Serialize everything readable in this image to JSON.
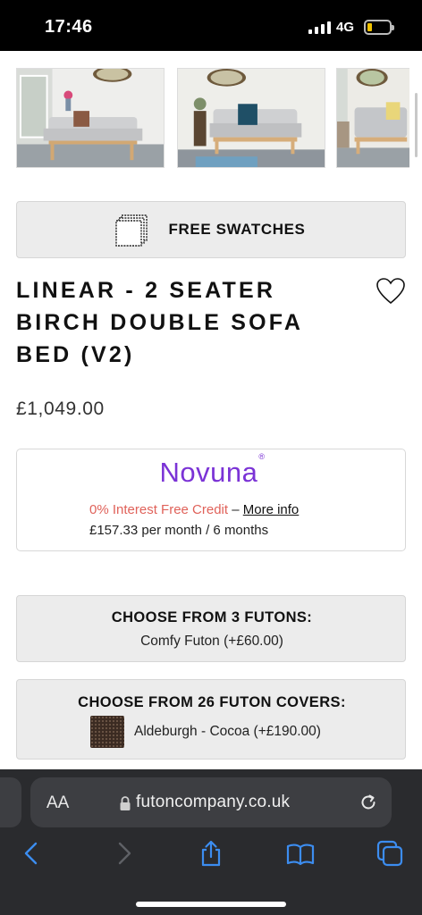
{
  "status_bar": {
    "time": "17:46",
    "network": "4G"
  },
  "gallery": {
    "images": [
      "sofa-bed-photo-1",
      "sofa-bed-photo-2",
      "sofa-bed-photo-3"
    ]
  },
  "swatches": {
    "label": "FREE SWATCHES",
    "icon": "swatch-icon"
  },
  "product": {
    "title": "LINEAR - 2 SEATER BIRCH DOUBLE SOFA BED (V2)",
    "price": "£1,049.00",
    "wishlist_icon": "heart-icon"
  },
  "finance": {
    "brand": "Novuna",
    "brand_mark": "®",
    "brand_color": "#7b33d6",
    "credit_text": "0% Interest Free Credit",
    "separator": " – ",
    "more_info": "More info",
    "monthly": "£157.33 per month / 6 months"
  },
  "options": {
    "futon": {
      "title": "CHOOSE FROM 3 FUTONS:",
      "value": "Comfy Futon (+£60.00)"
    },
    "cover": {
      "title": "CHOOSE FROM 26 FUTON COVERS:",
      "value": "Aldeburgh - Cocoa (+£190.00)"
    }
  },
  "browser": {
    "text_size_label": "AA",
    "url": "futoncompany.co.uk",
    "toolbar": [
      "back-icon",
      "forward-icon",
      "share-icon",
      "bookmarks-icon",
      "tabs-icon"
    ],
    "accent": "#3c8df0"
  }
}
